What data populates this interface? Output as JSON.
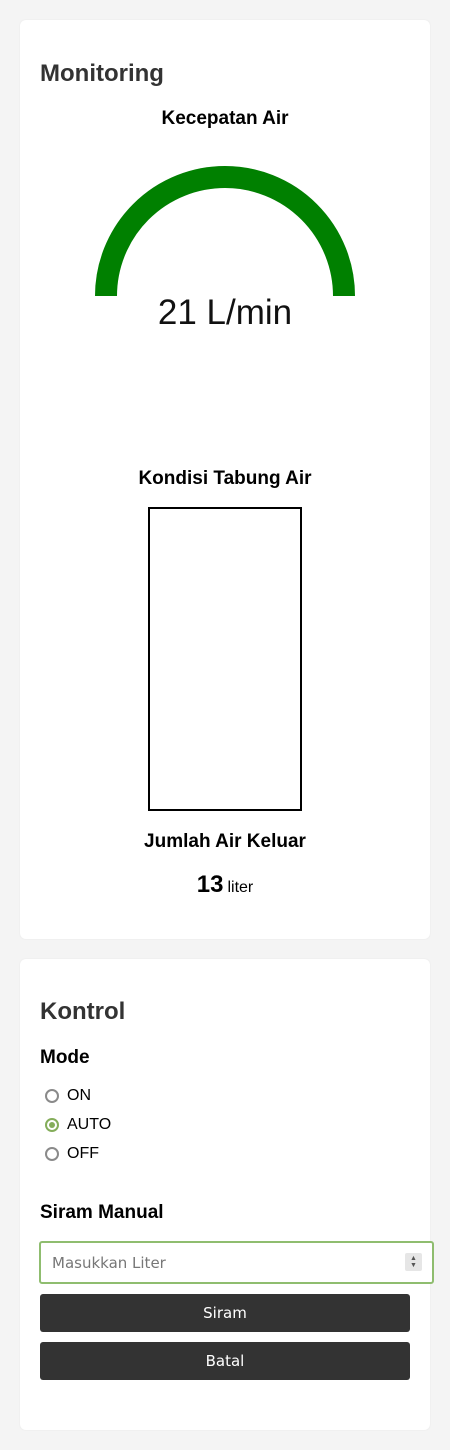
{
  "monitoring": {
    "title": "Monitoring",
    "speed": {
      "heading": "Kecepatan Air",
      "value": 21,
      "max": 21,
      "unit": "L/min",
      "display": "21 L/min",
      "gauge_color": "#008000",
      "track_color": "#e0e0e0"
    },
    "tank": {
      "heading": "Kondisi Tabung Air",
      "level_percent": 0,
      "fill_color": "#2f7de1"
    },
    "outflow": {
      "heading": "Jumlah Air Keluar",
      "value": "13",
      "unit": "liter"
    }
  },
  "kontrol": {
    "title": "Kontrol",
    "mode": {
      "heading": "Mode",
      "options": [
        {
          "label": "ON",
          "checked": false
        },
        {
          "label": "AUTO",
          "checked": true
        },
        {
          "label": "OFF",
          "checked": false
        }
      ],
      "accent_color": "#84ad5a"
    },
    "manual": {
      "heading": "Siram Manual",
      "input_value": "",
      "input_placeholder": "Masukkan Liter",
      "siram_label": "Siram",
      "batal_label": "Batal"
    }
  }
}
